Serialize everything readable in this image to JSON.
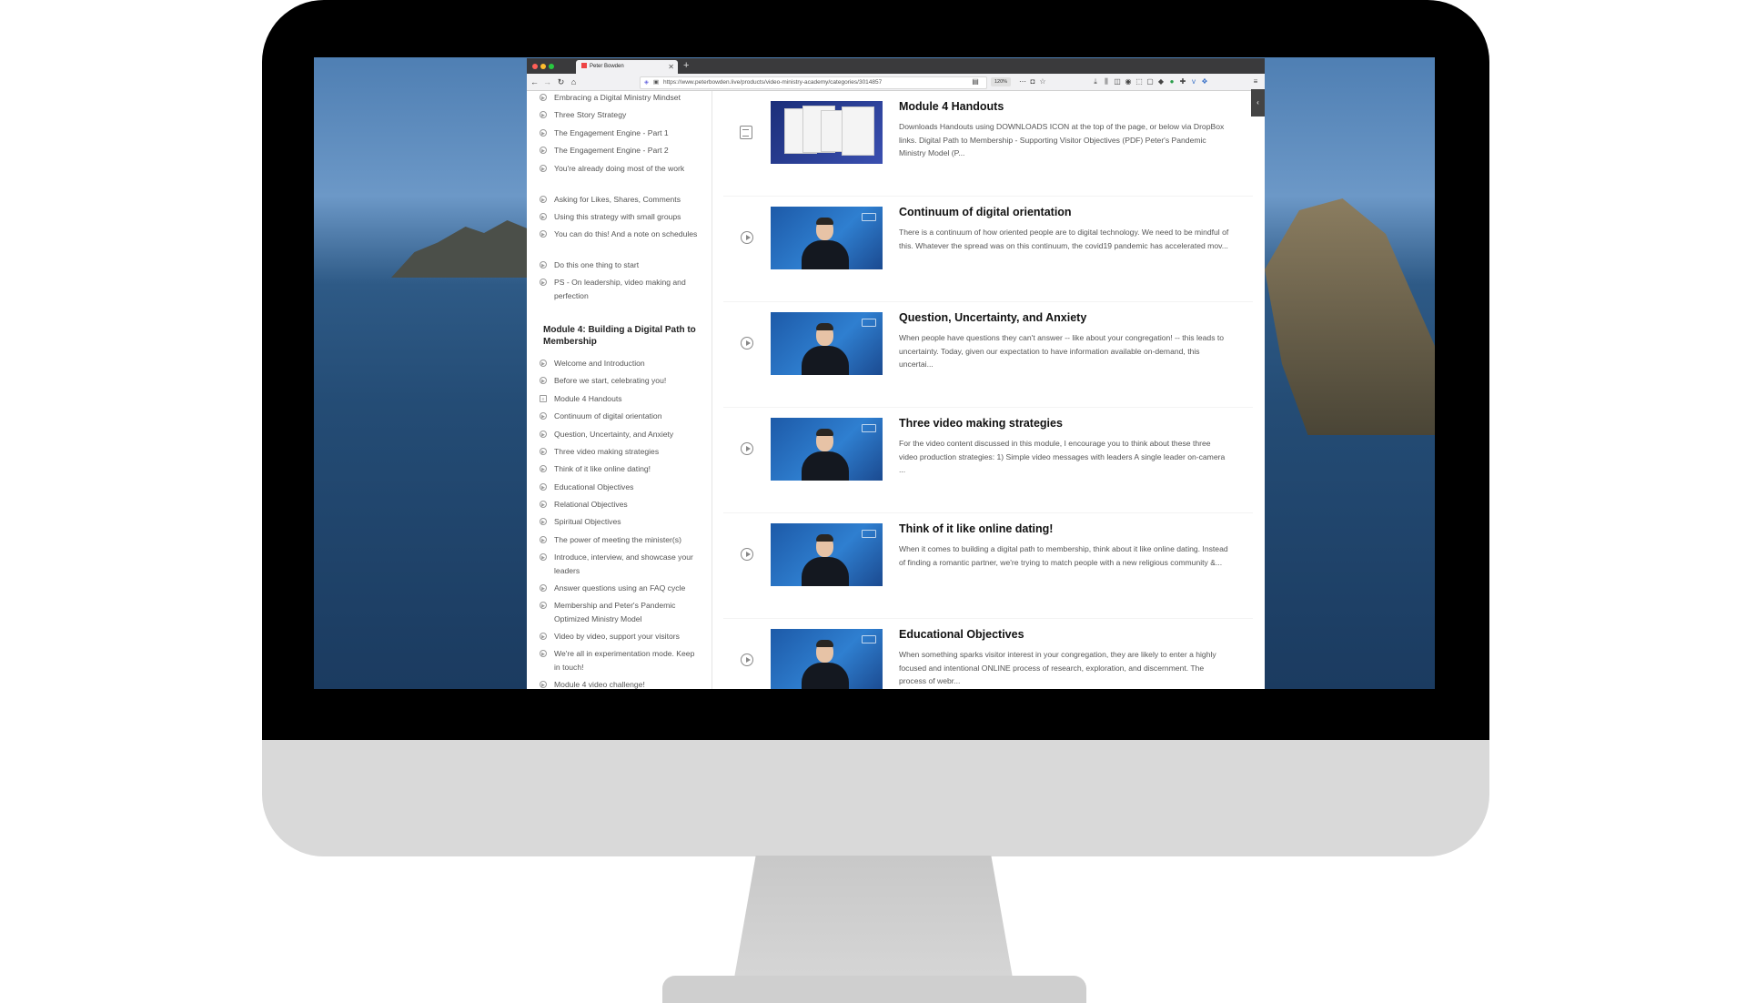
{
  "browser": {
    "tab_title": "Peter Bowden",
    "url": "https://www.peterbowden.live/products/video-ministry-academy/categories/3014857",
    "zoom": "120%"
  },
  "sidebar": {
    "lessons_top": [
      {
        "label": "Embracing a Digital Ministry Mindset",
        "icon": "play-circle-icon"
      },
      {
        "label": "Three Story Strategy",
        "icon": "play-circle-icon"
      },
      {
        "label": "The Engagement Engine - Part 1",
        "icon": "play-circle-icon"
      },
      {
        "label": "The Engagement Engine - Part 2",
        "icon": "play-circle-icon"
      },
      {
        "label": "You're already doing most of the work",
        "icon": "play-circle-icon"
      },
      {
        "label": "Asking for Likes, Shares, Comments",
        "icon": "play-circle-icon"
      },
      {
        "label": "Using this strategy with small groups",
        "icon": "play-circle-icon"
      },
      {
        "label": "You can do this! And a note on schedules",
        "icon": "play-circle-icon"
      },
      {
        "label": "Do this one thing to start",
        "icon": "play-circle-icon"
      },
      {
        "label": "PS - On leadership, video making and perfection",
        "icon": "play-circle-icon"
      }
    ],
    "module_title": "Module 4: Building a Digital Path to Membership",
    "lessons_module4": [
      {
        "label": "Welcome and Introduction",
        "icon": "play-circle-icon"
      },
      {
        "label": "Before we start, celebrating you!",
        "icon": "play-circle-icon"
      },
      {
        "label": "Module 4 Handouts",
        "icon": "document-icon"
      },
      {
        "label": "Continuum of digital orientation",
        "icon": "play-circle-icon"
      },
      {
        "label": "Question, Uncertainty, and Anxiety",
        "icon": "play-circle-icon"
      },
      {
        "label": "Three video making strategies",
        "icon": "play-circle-icon"
      },
      {
        "label": "Think of it like online dating!",
        "icon": "play-circle-icon"
      },
      {
        "label": "Educational Objectives",
        "icon": "play-circle-icon"
      },
      {
        "label": "Relational Objectives",
        "icon": "play-circle-icon"
      },
      {
        "label": "Spiritual Objectives",
        "icon": "play-circle-icon"
      },
      {
        "label": "The power of meeting the minister(s)",
        "icon": "play-circle-icon"
      },
      {
        "label": "Introduce, interview, and showcase your leaders",
        "icon": "play-circle-icon"
      },
      {
        "label": "Answer questions using an FAQ cycle",
        "icon": "play-circle-icon"
      },
      {
        "label": "Membership and Peter's Pandemic Optimized Ministry Model",
        "icon": "play-circle-icon"
      },
      {
        "label": "Video by video, support your visitors",
        "icon": "play-circle-icon"
      },
      {
        "label": "We're all in experimentation mode. Keep in touch!",
        "icon": "play-circle-icon"
      },
      {
        "label": "Module 4 video challenge!",
        "icon": "play-circle-icon"
      }
    ]
  },
  "main": {
    "cards": [
      {
        "title": "Module 4 Handouts",
        "type": "document",
        "description": "Downloads Handouts using DOWNLOADS ICON at the top of the page, or below via DropBox links. Digital Path to Membership - Supporting Visitor Objectives (PDF) Peter's Pandemic Ministry Model (P..."
      },
      {
        "title": "Continuum of digital orientation",
        "type": "video",
        "description": "There is a continuum of how oriented people are to digital technology.  We need to be mindful of this.  Whatever the spread was on this continuum, the covid19 pandemic has accelerated mov..."
      },
      {
        "title": "Question, Uncertainty, and Anxiety",
        "type": "video",
        "description": "When people have questions they can't answer -- like about your congregation! -- this leads to uncertainty.  Today, given our expectation to have information available on-demand, this uncertai..."
      },
      {
        "title": "Three video making strategies",
        "type": "video",
        "description": "For the video content discussed in this module,  I encourage you to think about these three video production strategies: 1)  Simple video messages with leaders A single leader on-camera ..."
      },
      {
        "title": "Think of it like online dating!",
        "type": "video",
        "description": "When it comes to building a digital path to membership, think about it like online dating.  Instead of finding a romantic partner, we're trying to match people with a new religious community &..."
      },
      {
        "title": "Educational Objectives",
        "type": "video",
        "description": "When something sparks visitor interest in your congregation, they are likely to enter a highly focused and intentional ONLINE process of research, exploration, and discernment.  The process of webr..."
      }
    ]
  }
}
